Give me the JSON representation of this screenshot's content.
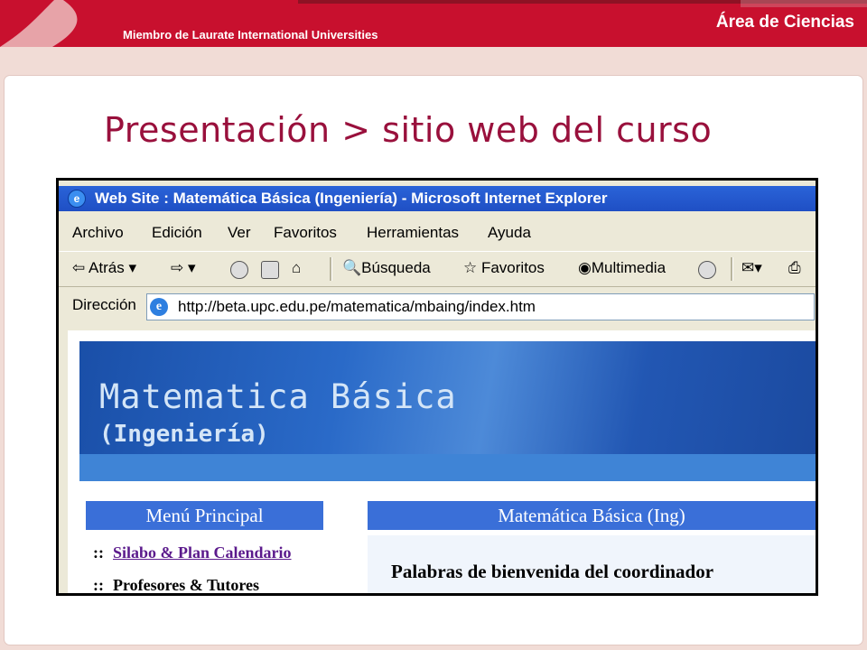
{
  "header": {
    "member_text": "Miembro de Laurate International Universities",
    "area_text": "Área de Ciencias",
    "brand_color": "#c8102e"
  },
  "slide": {
    "title": "Presentación > sitio web del curso",
    "title_color": "#99103c"
  },
  "browser": {
    "window_title": "Web Site : Matemática Básica (Ingeniería) - Microsoft Internet Explorer",
    "menu": [
      "Archivo",
      "Edición",
      "Ver",
      "Favoritos",
      "Herramientas",
      "Ayuda"
    ],
    "toolbar": {
      "back": "Atrás",
      "search": "Búsqueda",
      "favorites": "Favoritos",
      "multimedia": "Multimedia"
    },
    "address_label": "Dirección",
    "url": "http://beta.upc.edu.pe/matematica/mbaing/index.htm"
  },
  "site": {
    "banner_title": "Matematica Básica",
    "banner_subtitle": "(Ingeniería)",
    "menu_heading": "Menú Principal",
    "menu_items": [
      "Silabo & Plan Calendario",
      "Profesores & Tutores"
    ],
    "bullet": "::",
    "main_heading": "Matemática Básica (Ing)",
    "welcome": "Palabras de bienvenida del coordinador"
  }
}
